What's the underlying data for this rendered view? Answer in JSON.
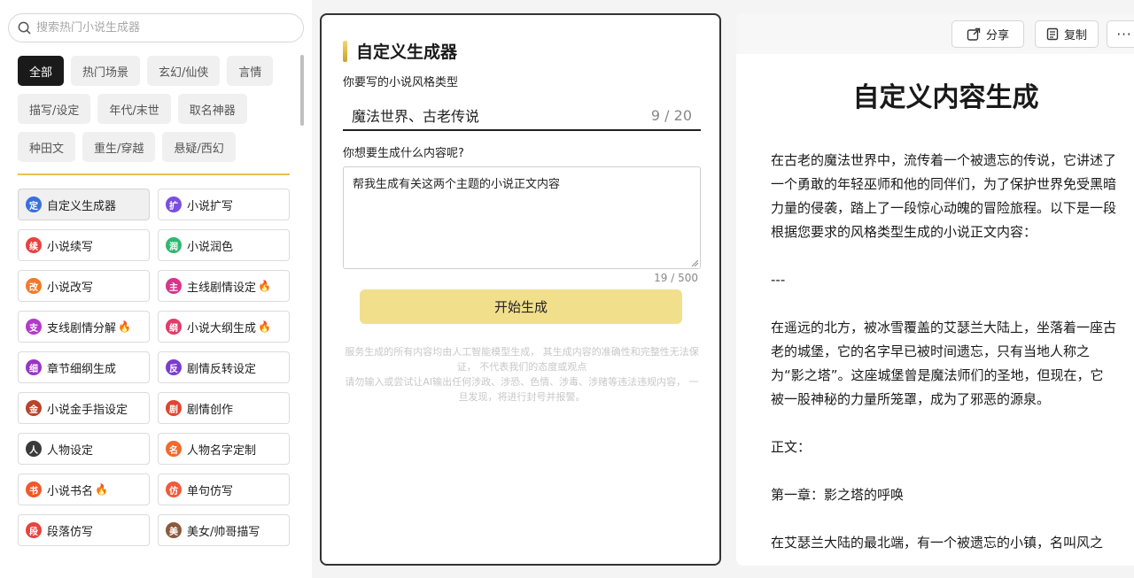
{
  "search": {
    "placeholder": "搜索热门小说生成器"
  },
  "categories": [
    {
      "label": "全部",
      "active": true
    },
    {
      "label": "热门场景"
    },
    {
      "label": "玄幻/仙侠"
    },
    {
      "label": "言情"
    },
    {
      "label": "描写/设定"
    },
    {
      "label": "年代/末世"
    },
    {
      "label": "取名神器"
    },
    {
      "label": "种田文"
    },
    {
      "label": "重生/穿越"
    },
    {
      "label": "悬疑/西幻"
    }
  ],
  "tools": [
    {
      "label": "自定义生成器",
      "icon": "定",
      "color": "#3b6fe0",
      "active": true
    },
    {
      "label": "小说扩写",
      "icon": "扩",
      "color": "#7a4fe0"
    },
    {
      "label": "小说续写",
      "icon": "续",
      "color": "#e8423f"
    },
    {
      "label": "小说润色",
      "icon": "润",
      "color": "#2eb872"
    },
    {
      "label": "小说改写",
      "icon": "改",
      "color": "#f07a2a"
    },
    {
      "label": "主线剧情设定",
      "icon": "主",
      "color": "#d8348a",
      "hot": true
    },
    {
      "label": "支线剧情分解",
      "icon": "支",
      "color": "#b23ac9",
      "hot": true
    },
    {
      "label": "小说大纲生成",
      "icon": "纲",
      "color": "#e23b6a",
      "hot": true
    },
    {
      "label": "章节细纲生成",
      "icon": "细",
      "color": "#9b34c2"
    },
    {
      "label": "剧情反转设定",
      "icon": "反",
      "color": "#7a3ccf"
    },
    {
      "label": "小说金手指设定",
      "icon": "金",
      "color": "#b8442c"
    },
    {
      "label": "剧情创作",
      "icon": "剧",
      "color": "#e0452f"
    },
    {
      "label": "人物设定",
      "icon": "人",
      "color": "#3a3a3a"
    },
    {
      "label": "人物名字定制",
      "icon": "名",
      "color": "#f06a2a"
    },
    {
      "label": "小说书名",
      "icon": "书",
      "color": "#f0592a",
      "hot": true
    },
    {
      "label": "单句仿写",
      "icon": "仿",
      "color": "#f05a3a"
    },
    {
      "label": "段落仿写",
      "icon": "段",
      "color": "#e8423f"
    },
    {
      "label": "美女/帅哥描写",
      "icon": "美",
      "color": "#8a5a3a"
    }
  ],
  "hot_icon": "fire-icon",
  "main": {
    "title": "自定义生成器",
    "style_label": "你要写的小说风格类型",
    "style_value": "魔法世界、古老传说",
    "style_count": "9 / 20",
    "content_label": "你想要生成什么内容呢?",
    "content_value": "帮我生成有关这两个主题的小说正文内容",
    "content_count": "19 / 500",
    "generate_label": "开始生成",
    "disclaimer_1": "服务生成的所有内容均由人工智能模型生成， 其生成内容的准确性和完整性无法保证， 不代表我们的态度或观点",
    "disclaimer_2": "请勿输入或尝试让AI输出任何涉政、涉恐、色情、涉毒、涉赌等违法违规内容， 一旦发现，将进行封号并报警。"
  },
  "result": {
    "share_label": "分享",
    "copy_label": "复制",
    "more_label": "···",
    "title": "自定义内容生成",
    "paragraphs": [
      "在古老的魔法世界中，流传着一个被遗忘的传说，它讲述了一个勇敢的年轻巫师和他的同伴们，为了保护世界免受黑暗力量的侵袭，踏上了一段惊心动魄的冒险旅程。以下是一段根据您要求的风格类型生成的小说正文内容：",
      "---",
      "在遥远的北方，被冰雪覆盖的艾瑟兰大陆上，坐落着一座古老的城堡，它的名字早已被时间遗忘，只有当地人称之为“影之塔”。这座城堡曾是魔法师们的圣地，但现在，它被一股神秘的力量所笼罩，成为了邪恶的源泉。",
      "正文：",
      "第一章：影之塔的呼唤",
      "在艾瑟兰大陆的最北端，有一个被遗忘的小镇，名叫风之"
    ]
  }
}
